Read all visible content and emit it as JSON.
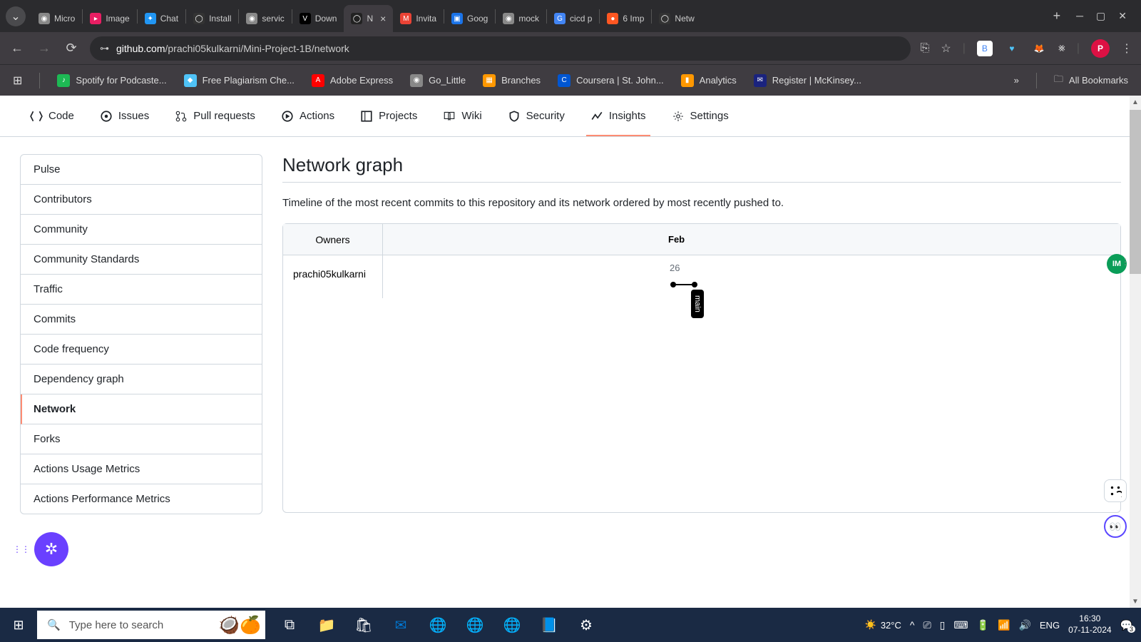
{
  "browser": {
    "tabs": [
      {
        "title": "Micro",
        "fav_bg": "#888",
        "fav_txt": "◉"
      },
      {
        "title": "Image",
        "fav_bg": "#e91e63",
        "fav_txt": "▸"
      },
      {
        "title": "Chat",
        "fav_bg": "#2196f3",
        "fav_txt": "✦"
      },
      {
        "title": "Install",
        "fav_bg": "#333",
        "fav_txt": "◯"
      },
      {
        "title": "servic",
        "fav_bg": "#888",
        "fav_txt": "◉"
      },
      {
        "title": "Down",
        "fav_bg": "#000",
        "fav_txt": "V"
      },
      {
        "title": "N",
        "fav_bg": "#222",
        "fav_txt": "◯",
        "active": true,
        "closeable": true
      },
      {
        "title": "Invita",
        "fav_bg": "#ea4335",
        "fav_txt": "M"
      },
      {
        "title": "Goog",
        "fav_bg": "#1a73e8",
        "fav_txt": "▣"
      },
      {
        "title": "mock",
        "fav_bg": "#888",
        "fav_txt": "◉"
      },
      {
        "title": "cicd p",
        "fav_bg": "#4285f4",
        "fav_txt": "G"
      },
      {
        "title": "6 Imp",
        "fav_bg": "#ff5722",
        "fav_txt": "●"
      },
      {
        "title": "Netw",
        "fav_bg": "#333",
        "fav_txt": "◯"
      }
    ],
    "url_prefix": "github.com",
    "url_path": "/prachi05kulkarni/Mini-Project-1B/network",
    "profile_letter": "P"
  },
  "bookmarks": [
    {
      "label": "Spotify for Podcaste...",
      "bg": "#1db954",
      "icon": "♪"
    },
    {
      "label": "Free Plagiarism Che...",
      "bg": "#4fc3f7",
      "icon": "◆"
    },
    {
      "label": "Adobe Express",
      "bg": "#ff0000",
      "icon": "A"
    },
    {
      "label": "Go_Little",
      "bg": "#888",
      "icon": "◉"
    },
    {
      "label": "Branches",
      "bg": "#ff9800",
      "icon": "▦"
    },
    {
      "label": "Coursera | St. John...",
      "bg": "#0056d2",
      "icon": "C"
    },
    {
      "label": "Analytics",
      "bg": "#ff9800",
      "icon": "▮"
    },
    {
      "label": "Register | McKinsey...",
      "bg": "#1a237e",
      "icon": "✉"
    }
  ],
  "bookmarks_all": "All Bookmarks",
  "repo_tabs": [
    {
      "label": "Code",
      "icon": "code-icon"
    },
    {
      "label": "Issues",
      "icon": "issue-icon"
    },
    {
      "label": "Pull requests",
      "icon": "pr-icon"
    },
    {
      "label": "Actions",
      "icon": "play-icon"
    },
    {
      "label": "Projects",
      "icon": "project-icon"
    },
    {
      "label": "Wiki",
      "icon": "book-icon"
    },
    {
      "label": "Security",
      "icon": "shield-icon"
    },
    {
      "label": "Insights",
      "icon": "graph-icon",
      "active": true
    },
    {
      "label": "Settings",
      "icon": "gear-icon"
    }
  ],
  "sidebar": {
    "items": [
      "Pulse",
      "Contributors",
      "Community",
      "Community Standards",
      "Traffic",
      "Commits",
      "Code frequency",
      "Dependency graph",
      "Network",
      "Forks",
      "Actions Usage Metrics",
      "Actions Performance Metrics"
    ],
    "active_index": 8
  },
  "content": {
    "title": "Network graph",
    "subtitle": "Timeline of the most recent commits to this repository and its network ordered by most recently pushed to.",
    "owners_header": "Owners",
    "month": "Feb",
    "day": "26",
    "owner": "prachi05kulkarni",
    "branch": "main"
  },
  "taskbar": {
    "search_placeholder": "Type here to search",
    "temp": "32°C",
    "lang": "ENG",
    "time": "16:30",
    "date": "07-11-2024",
    "notif_count": "3"
  }
}
